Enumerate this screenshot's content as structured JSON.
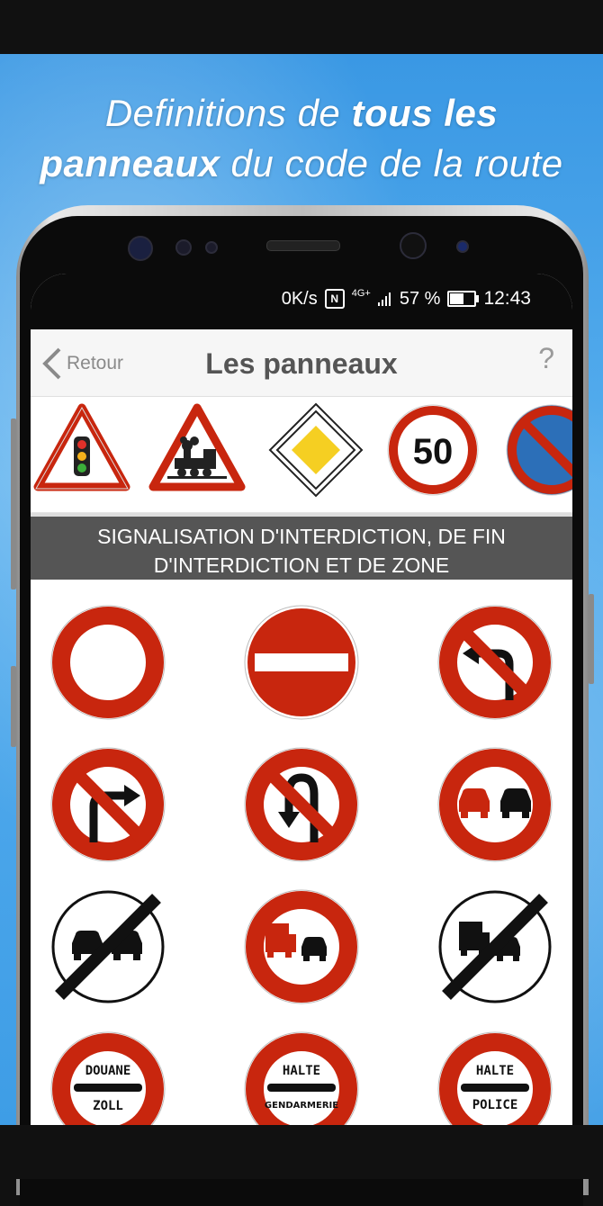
{
  "promo": {
    "line1_a": "Definitions de ",
    "line1_b": "tous les",
    "line2_a": "panneaux",
    "line2_b": " du code de la route"
  },
  "statusbar": {
    "speed": "0K/s",
    "network": "4G+",
    "battery_percent": "57 %",
    "battery_level": 0.57,
    "time": "12:43"
  },
  "appbar": {
    "back_label": "Retour",
    "title": "Les panneaux",
    "help_label": "?"
  },
  "categories": [
    {
      "icon": "traffic-light-warning-sign"
    },
    {
      "icon": "train-crossing-warning-sign"
    },
    {
      "icon": "priority-road-sign"
    },
    {
      "icon": "speed-limit-sign",
      "text": "50"
    },
    {
      "icon": "no-parking-sign"
    }
  ],
  "section": {
    "title": "SIGNALISATION D'INTERDICTION, DE FIN D'INTERDICTION ET DE ZONE"
  },
  "signs": {
    "douane_top": "DOUANE",
    "douane_bottom": "ZOLL",
    "halte1_top": "HALTE",
    "halte1_bottom": "GENDARMERIE",
    "halte2_top": "HALTE",
    "halte2_bottom": "POLICE"
  },
  "colors": {
    "red": "#c8260e",
    "sky": "#3e9de6",
    "section_bg": "#555555",
    "yellow": "#f5cf22",
    "blue": "#2c6fb8"
  }
}
